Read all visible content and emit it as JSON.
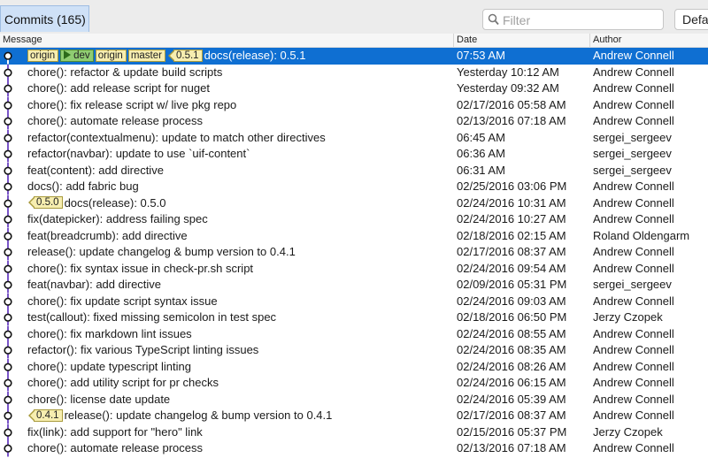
{
  "toolbar": {
    "tab_label": "Commits (165)",
    "search_placeholder": "Filter",
    "default_label": "Defau"
  },
  "columns": {
    "message": "Message",
    "date": "Date",
    "author": "Author"
  },
  "colors": {
    "selection": "#0f6fd2",
    "graph_line": "#7a55c8",
    "tag_bg": "#f7eeb0",
    "branch_bg": "#8fcd72"
  },
  "commits": [
    {
      "refs": [
        {
          "kind": "remote",
          "text": "origin"
        },
        {
          "kind": "branch",
          "text": "dev"
        },
        {
          "kind": "remote",
          "text": "origin"
        },
        {
          "kind": "remote",
          "text": "master"
        },
        {
          "kind": "tag",
          "text": "0.5.1"
        }
      ],
      "message": "docs(release): 0.5.1",
      "date": "07:53 AM",
      "author": "Andrew Connell",
      "selected": true
    },
    {
      "refs": [],
      "message": "chore(): refactor & update build scripts",
      "date": "Yesterday 10:12 AM",
      "author": "Andrew Connell"
    },
    {
      "refs": [],
      "message": "chore(): add release script for nuget",
      "date": "Yesterday 09:32 AM",
      "author": "Andrew Connell"
    },
    {
      "refs": [],
      "message": "chore(): fix release script w/ live pkg repo",
      "date": "02/17/2016 05:58 AM",
      "author": "Andrew Connell"
    },
    {
      "refs": [],
      "message": "chore(): automate release process",
      "date": "02/13/2016 07:18 AM",
      "author": "Andrew Connell"
    },
    {
      "refs": [],
      "message": "refactor(contextualmenu): update to match other directives",
      "date": "06:45 AM",
      "author": "sergei_sergeev"
    },
    {
      "refs": [],
      "message": "refactor(navbar): update to use `uif-content`",
      "date": "06:36 AM",
      "author": "sergei_sergeev"
    },
    {
      "refs": [],
      "message": "feat(content): add directive",
      "date": "06:31 AM",
      "author": "sergei_sergeev"
    },
    {
      "refs": [],
      "message": "docs(): add fabric bug",
      "date": "02/25/2016 03:06 PM",
      "author": "Andrew Connell"
    },
    {
      "refs": [
        {
          "kind": "tag",
          "text": "0.5.0"
        }
      ],
      "message": "docs(release): 0.5.0",
      "date": "02/24/2016 10:31 AM",
      "author": "Andrew Connell"
    },
    {
      "refs": [],
      "message": "fix(datepicker): address failing spec",
      "date": "02/24/2016 10:27 AM",
      "author": "Andrew Connell"
    },
    {
      "refs": [],
      "message": "feat(breadcrumb): add directive",
      "date": "02/18/2016 02:15 AM",
      "author": "Roland Oldengarm"
    },
    {
      "refs": [],
      "message": "release(): update changelog & bump version to 0.4.1",
      "date": "02/17/2016 08:37 AM",
      "author": "Andrew Connell"
    },
    {
      "refs": [],
      "message": "chore(): fix syntax issue in check-pr.sh script",
      "date": "02/24/2016 09:54 AM",
      "author": "Andrew Connell"
    },
    {
      "refs": [],
      "message": "feat(navbar): add directive",
      "date": "02/09/2016 05:31 PM",
      "author": "sergei_sergeev"
    },
    {
      "refs": [],
      "message": "chore(): fix update script syntax issue",
      "date": "02/24/2016 09:03 AM",
      "author": "Andrew Connell"
    },
    {
      "refs": [],
      "message": "test(callout): fixed missing semicolon in test spec",
      "date": "02/18/2016 06:50 PM",
      "author": "Jerzy Czopek"
    },
    {
      "refs": [],
      "message": "chore(): fix markdown lint issues",
      "date": "02/24/2016 08:55 AM",
      "author": "Andrew Connell"
    },
    {
      "refs": [],
      "message": "refactor(): fix various TypeScript linting issues",
      "date": "02/24/2016 08:35 AM",
      "author": "Andrew Connell"
    },
    {
      "refs": [],
      "message": "chore(): update typescript linting",
      "date": "02/24/2016 08:26 AM",
      "author": "Andrew Connell"
    },
    {
      "refs": [],
      "message": "chore(): add utility script for pr checks",
      "date": "02/24/2016 06:15 AM",
      "author": "Andrew Connell"
    },
    {
      "refs": [],
      "message": "chore(): license date update",
      "date": "02/24/2016 05:39 AM",
      "author": "Andrew Connell"
    },
    {
      "refs": [
        {
          "kind": "tag",
          "text": "0.4.1"
        }
      ],
      "message": "release(): update changelog & bump version to 0.4.1",
      "date": "02/17/2016 08:37 AM",
      "author": "Andrew Connell"
    },
    {
      "refs": [],
      "message": "fix(link): add support for \"hero\" link",
      "date": "02/15/2016 05:37 PM",
      "author": "Jerzy Czopek"
    },
    {
      "refs": [],
      "message": "chore(): automate release process",
      "date": "02/13/2016 07:18 AM",
      "author": "Andrew Connell"
    }
  ]
}
